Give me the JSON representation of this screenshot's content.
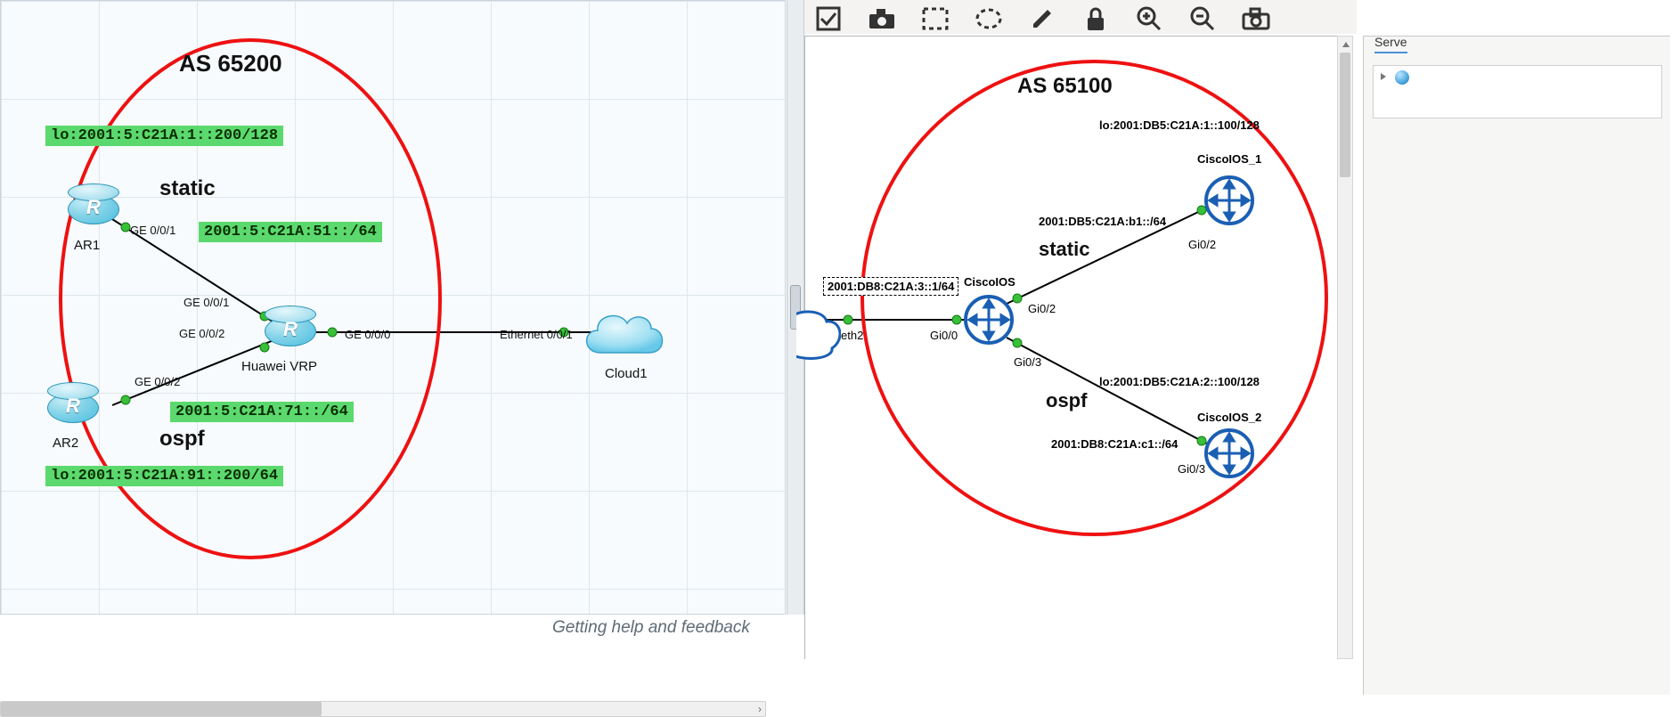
{
  "left": {
    "as_title": "AS 65200",
    "section_static": "static",
    "section_ospf": "ospf",
    "addr_lo_ar1": "lo:2001:5:C21A:1::200/128",
    "addr_link_static": "2001:5:C21A:51::/64",
    "addr_link_ospf": "2001:5:C21A:71::/64",
    "addr_lo_ar2": "lo:2001:5:C21A:91::200/64",
    "devices": {
      "ar1": "AR1",
      "ar2": "AR2",
      "hub": "Huawei VRP",
      "cloud": "Cloud1"
    },
    "ifaces": {
      "ar1_out": "GE 0/0/1",
      "hub_in_top": "GE 0/0/1",
      "ar2_out": "GE 0/0/2",
      "hub_in_bot": "GE 0/0/2",
      "hub_out": "GE 0/0/0",
      "cloud_in": "Ethernet 0/0/1"
    },
    "footer": "Getting help and feedback"
  },
  "right": {
    "as_title": "AS 65100",
    "section_static": "static",
    "section_ospf": "ospf",
    "devices": {
      "hub": "CiscoIOS",
      "r1": "CiscoIOS_1",
      "r2": "CiscoIOS_2"
    },
    "addr_box": "2001:DB8:C21A:3::1/64",
    "addr_link_static": "2001:DB5:C21A:b1::/64",
    "addr_lo_r1": "lo:2001:DB5:C21A:1::100/128",
    "addr_link_ospf": "2001:DB8:C21A:c1::/64",
    "addr_lo_r2": "lo:2001:DB5:C21A:2::100/128",
    "ifaces": {
      "cloud_out": "eth2",
      "hub_in": "Gi0/0",
      "hub_up": "Gi0/2",
      "r1_down": "Gi0/2",
      "hub_down": "Gi0/3",
      "r2_up": "Gi0/3"
    }
  },
  "side": {
    "tab": "Serve"
  },
  "toolbar_icons": [
    "checkbox-icon",
    "camera-icon",
    "rect-dashed-icon",
    "ellipse-dashed-icon",
    "pencil-icon",
    "lock-icon",
    "zoom-in-icon",
    "zoom-out-icon",
    "camera2-icon"
  ]
}
